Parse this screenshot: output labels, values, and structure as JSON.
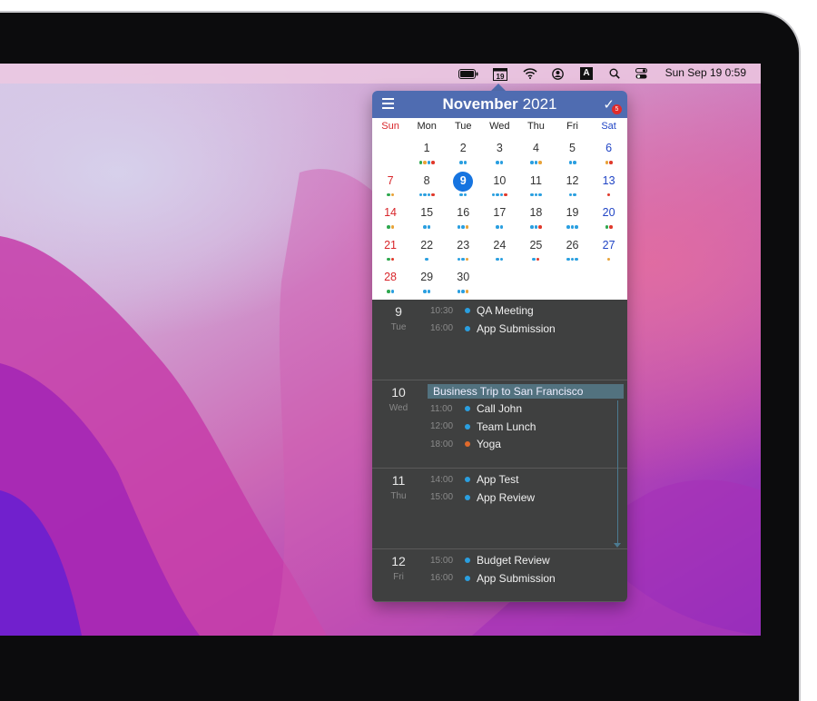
{
  "menubar": {
    "calendar_date": "19",
    "input_letter": "A",
    "clock": "Sun Sep 19  0:59"
  },
  "calendar": {
    "month": "November",
    "year": "2021",
    "badge_count": "5",
    "weekdays": [
      "Sun",
      "Mon",
      "Tue",
      "Wed",
      "Thu",
      "Fri",
      "Sat"
    ],
    "weeks": [
      [
        {
          "d": "",
          "dots": []
        },
        {
          "d": "1",
          "dots": [
            "#2fa84f",
            "#e8a33a",
            "#2a9fe0",
            "#e0392b"
          ]
        },
        {
          "d": "2",
          "dots": [
            "#2a9fe0",
            "#2a9fe0"
          ]
        },
        {
          "d": "3",
          "dots": [
            "#2a9fe0",
            "#2a9fe0"
          ]
        },
        {
          "d": "4",
          "dots": [
            "#2a9fe0",
            "#2a9fe0",
            "#e8a33a"
          ]
        },
        {
          "d": "5",
          "dots": [
            "#2a9fe0",
            "#2a9fe0"
          ]
        },
        {
          "d": "6",
          "dots": [
            "#e8a33a",
            "#e0392b"
          ]
        }
      ],
      [
        {
          "d": "7",
          "dots": [
            "#2fa84f",
            "#e8a33a"
          ]
        },
        {
          "d": "8",
          "dots": [
            "#2a9fe0",
            "#2a9fe0",
            "#2a9fe0",
            "#e0392b"
          ]
        },
        {
          "d": "9",
          "dots": [
            "#2a9fe0",
            "#2a9fe0"
          ],
          "today": true
        },
        {
          "d": "10",
          "dots": [
            "#2a9fe0",
            "#2a9fe0",
            "#2a9fe0",
            "#e0392b"
          ]
        },
        {
          "d": "11",
          "dots": [
            "#2a9fe0",
            "#2a9fe0",
            "#2a9fe0"
          ]
        },
        {
          "d": "12",
          "dots": [
            "#2a9fe0",
            "#2a9fe0"
          ]
        },
        {
          "d": "13",
          "dots": [
            "#e0392b"
          ]
        }
      ],
      [
        {
          "d": "14",
          "dots": [
            "#2fa84f",
            "#e8a33a"
          ]
        },
        {
          "d": "15",
          "dots": [
            "#2a9fe0",
            "#2a9fe0"
          ]
        },
        {
          "d": "16",
          "dots": [
            "#2a9fe0",
            "#2a9fe0",
            "#e8a33a"
          ]
        },
        {
          "d": "17",
          "dots": [
            "#2a9fe0",
            "#2a9fe0"
          ]
        },
        {
          "d": "18",
          "dots": [
            "#2a9fe0",
            "#2a9fe0",
            "#e0392b"
          ]
        },
        {
          "d": "19",
          "dots": [
            "#2a9fe0",
            "#2a9fe0",
            "#2a9fe0"
          ]
        },
        {
          "d": "20",
          "dots": [
            "#2fa84f",
            "#e0392b"
          ]
        }
      ],
      [
        {
          "d": "21",
          "dots": [
            "#2fa84f",
            "#e0392b"
          ]
        },
        {
          "d": "22",
          "dots": [
            "#2a9fe0"
          ]
        },
        {
          "d": "23",
          "dots": [
            "#2a9fe0",
            "#2a9fe0",
            "#e8a33a"
          ]
        },
        {
          "d": "24",
          "dots": [
            "#2a9fe0",
            "#2a9fe0"
          ]
        },
        {
          "d": "25",
          "dots": [
            "#2a9fe0",
            "#e0392b"
          ]
        },
        {
          "d": "26",
          "dots": [
            "#2a9fe0",
            "#2a9fe0",
            "#2a9fe0"
          ]
        },
        {
          "d": "27",
          "dots": [
            "#e8a33a"
          ]
        }
      ],
      [
        {
          "d": "28",
          "dots": [
            "#2fa84f",
            "#2a9fe0"
          ]
        },
        {
          "d": "29",
          "dots": [
            "#2a9fe0",
            "#2a9fe0"
          ]
        },
        {
          "d": "30",
          "dots": [
            "#2a9fe0",
            "#2a9fe0",
            "#e8a33a"
          ]
        },
        {
          "d": "",
          "dots": []
        },
        {
          "d": "",
          "dots": []
        },
        {
          "d": "",
          "dots": []
        },
        {
          "d": "",
          "dots": []
        }
      ]
    ]
  },
  "agenda": [
    {
      "day": "9",
      "weekday": "Tue",
      "events": [
        {
          "time": "10:30",
          "title": "QA Meeting",
          "color": "#2a9fe0"
        },
        {
          "time": "16:00",
          "title": "App Submission",
          "color": "#2a9fe0"
        }
      ]
    },
    {
      "day": "10",
      "weekday": "Wed",
      "allday": "Business Trip to San Francisco",
      "events": [
        {
          "time": "11:00",
          "title": "Call John",
          "color": "#2a9fe0"
        },
        {
          "time": "12:00",
          "title": "Team Lunch",
          "color": "#2a9fe0"
        },
        {
          "time": "18:00",
          "title": "Yoga",
          "color": "#e06a2b"
        }
      ]
    },
    {
      "day": "11",
      "weekday": "Thu",
      "events": [
        {
          "time": "14:00",
          "title": "App Test",
          "color": "#2a9fe0"
        },
        {
          "time": "15:00",
          "title": "App Review",
          "color": "#2a9fe0"
        }
      ]
    },
    {
      "day": "12",
      "weekday": "Fri",
      "events": [
        {
          "time": "15:00",
          "title": "Budget Review",
          "color": "#2a9fe0"
        },
        {
          "time": "16:00",
          "title": "App Submission",
          "color": "#2a9fe0"
        }
      ]
    }
  ]
}
